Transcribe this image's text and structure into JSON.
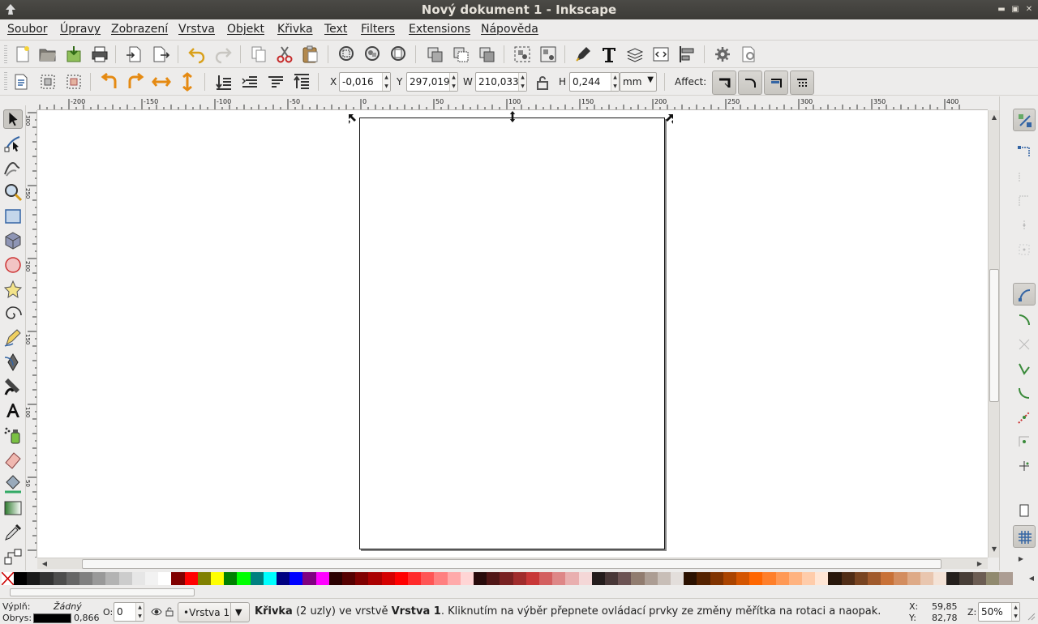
{
  "window": {
    "title": "Nový dokument 1 - Inkscape"
  },
  "menu": [
    "Soubor",
    "Úpravy",
    "Zobrazení",
    "Vrstva",
    "Objekt",
    "Křivka",
    "Text",
    "Filters",
    "Extensions",
    "Nápověda"
  ],
  "commands_toolbar": {
    "icons": [
      "new-document-icon",
      "open-icon",
      "import-icon",
      "print-icon",
      "import-file-icon",
      "export-icon",
      "undo-icon",
      "redo-icon",
      "copy-icon",
      "cut-icon",
      "paste-icon",
      "zoom-selection-icon",
      "zoom-drawing-icon",
      "zoom-page-icon",
      "duplicate-icon",
      "clone-icon",
      "unlink-clone-icon",
      "group-icon",
      "ungroup-icon",
      "fill-stroke-icon",
      "text-font-icon",
      "layers-icon",
      "xml-editor-icon",
      "align-distribute-icon",
      "preferences-icon",
      "document-properties-icon"
    ]
  },
  "controls_toolbar": {
    "x_label": "X",
    "x_value": "-0,016",
    "y_label": "Y",
    "y_value": "297,019",
    "w_label": "W",
    "w_value": "210,033",
    "h_label": "H",
    "h_value": "0,244",
    "unit": "mm",
    "affect_label": "Affect:"
  },
  "toolbox": {
    "tools": [
      "selector-tool-icon",
      "node-tool-icon",
      "tweak-tool-icon",
      "zoom-tool-icon",
      "rectangle-tool-icon",
      "3dbox-tool-icon",
      "ellipse-tool-icon",
      "star-tool-icon",
      "spiral-tool-icon",
      "pencil-tool-icon",
      "pen-tool-icon",
      "calligraphy-tool-icon",
      "text-tool-icon",
      "spray-tool-icon",
      "eraser-tool-icon",
      "paint-bucket-tool-icon",
      "gradient-tool-icon",
      "dropper-tool-icon",
      "connector-tool-icon"
    ],
    "active": "selector-tool-icon"
  },
  "ruler": {
    "h_labels": [
      "-200",
      "-150",
      "-100",
      "-50",
      "0",
      "50",
      "100",
      "150",
      "200",
      "250",
      "300",
      "350",
      "400"
    ],
    "v_labels": [
      "300",
      "250",
      "200",
      "150",
      "100",
      "50"
    ]
  },
  "palette": {
    "colors": [
      "#000000",
      "#1a1a1a",
      "#333333",
      "#4d4d4d",
      "#666666",
      "#808080",
      "#999999",
      "#b3b3b3",
      "#cccccc",
      "#e6e6e6",
      "#f2f2f2",
      "#ffffff",
      "#800000",
      "#ff0000",
      "#808000",
      "#ffff00",
      "#008000",
      "#00ff00",
      "#008080",
      "#00ffff",
      "#000080",
      "#0000ff",
      "#800080",
      "#ff00ff",
      "#2b0000",
      "#550000",
      "#800000",
      "#aa0000",
      "#d40000",
      "#ff0000",
      "#ff2a2a",
      "#ff5555",
      "#ff8080",
      "#ffaaaa",
      "#ffd5d5",
      "#280b0b",
      "#501616",
      "#782121",
      "#a02c2c",
      "#c83737",
      "#d35f5f",
      "#de8787",
      "#e9afaf",
      "#f4d7d7",
      "#241c1c",
      "#483737",
      "#6c5353",
      "#917c6f",
      "#ac9d93",
      "#c8beb7",
      "#e3dedb",
      "#2b1100",
      "#552200",
      "#803300",
      "#aa4400",
      "#d45500",
      "#ff6600",
      "#ff7f2a",
      "#ff9955",
      "#ffb380",
      "#ffccaa",
      "#ffe6d5",
      "#28170b",
      "#502d16",
      "#784421",
      "#a05a2c",
      "#c87137",
      "#d38d5f",
      "#deaa87",
      "#e9c6af",
      "#f4e3d7",
      "#241f1c",
      "#483e37",
      "#6c5d53",
      "#918a6f",
      "#ac9d93"
    ]
  },
  "status": {
    "fill_label": "Výplň:",
    "fill_value": "Žádný",
    "stroke_label": "Obrys:",
    "stroke_color": "#000000",
    "stroke_width": "0,866",
    "opacity_label": "O:",
    "opacity_value": "0",
    "layer": "•Vrstva 1",
    "message_bold1": "Křivka",
    "message_part1": " (2 uzly) ve vrstvě ",
    "message_bold2": "Vrstva 1",
    "message_part2": ". Kliknutím na výběr přepnete ovládací prvky ze změny měřítka na rotaci a naopak.",
    "cursor_x_label": "X:",
    "cursor_x": "59,85",
    "cursor_y_label": "Y:",
    "cursor_y": "82,78",
    "zoom_label": "Z:",
    "zoom_value": "50%"
  }
}
